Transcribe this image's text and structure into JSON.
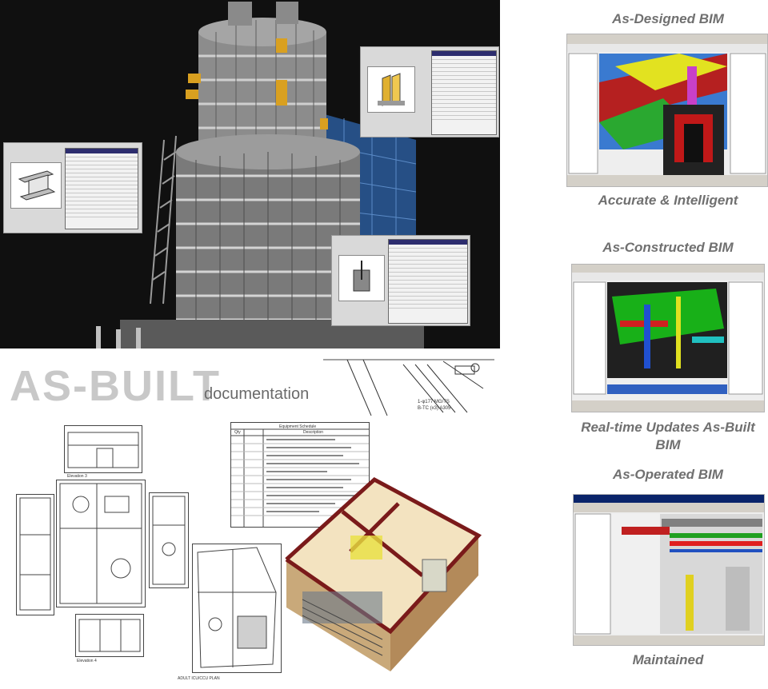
{
  "right_column": {
    "as_designed_title": "As-Designed BIM",
    "accurate_caption": "Accurate & Intelligent",
    "as_constructed_title": "As-Constructed BIM",
    "realtime_caption": "Real-time Updates As-Built BIM",
    "as_operated_title": "As-Operated BIM",
    "maintained_caption": "Maintained"
  },
  "as_built": {
    "title": "AS-BUILT",
    "subtitle": "documentation"
  },
  "drawing_labels": {
    "detail_note_1": "1-φ177 MG/TS",
    "detail_note_2": "B-TC (x3) A305",
    "elevation_3": "Elevation 3",
    "elevation_4": "Elevation 4",
    "plan_label": "ADULT ICU/CCU PLAN",
    "schedule_title": "Equipment Schedule",
    "schedule_col_qty": "Qty",
    "schedule_col_desc": "Description"
  },
  "colors": {
    "render_bg": "#101010",
    "title_gray": "#707070",
    "asbuilt_gray": "#c8c8c8"
  }
}
